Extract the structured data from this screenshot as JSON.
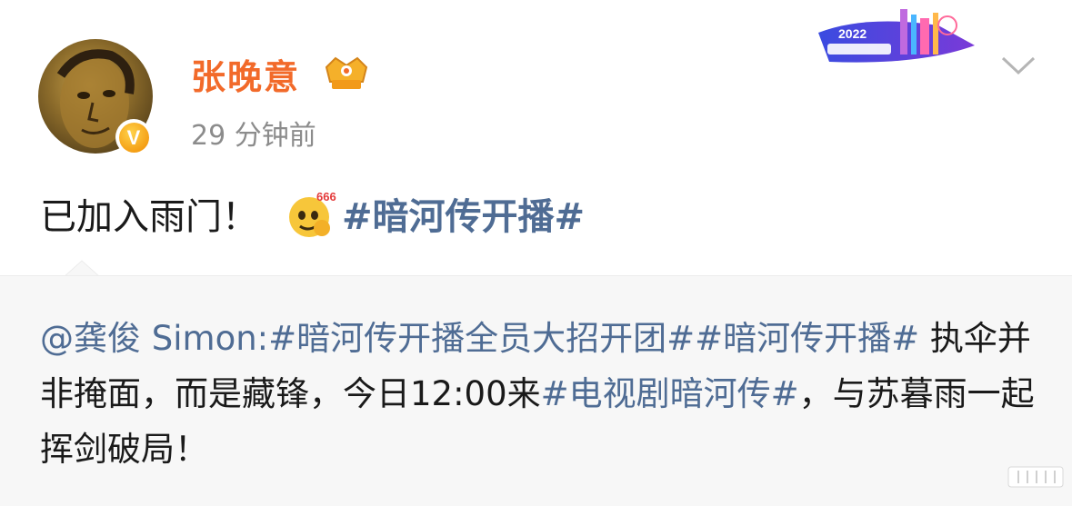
{
  "post": {
    "author": {
      "name": "张晚意",
      "avatar_icon": "portrait-avatar",
      "verified_badge": "V"
    },
    "timestamp": "29 分钟前",
    "badge_text": "2022",
    "text_prefix": "已加入雨门！",
    "emoji_name": "666-emoji",
    "emoji_label": "666",
    "hashtag": "#暗河传开播#",
    "repost": {
      "author_mention": "@龚俊 Simon:",
      "tag1": "#暗河传开播全员大招开团#",
      "tag2": "#暗河传开播#",
      "text1": " 执伞并非掩面，而是藏锋，今日12:00来",
      "tag3": "#电视剧暗河传#",
      "text2": "，与苏暮雨一起挥剑破局！"
    }
  },
  "colors": {
    "accent_name": "#f26a2a",
    "link": "#4f6c94",
    "timestamp": "#8c8c8c",
    "repost_bg": "#f7f7f7"
  }
}
